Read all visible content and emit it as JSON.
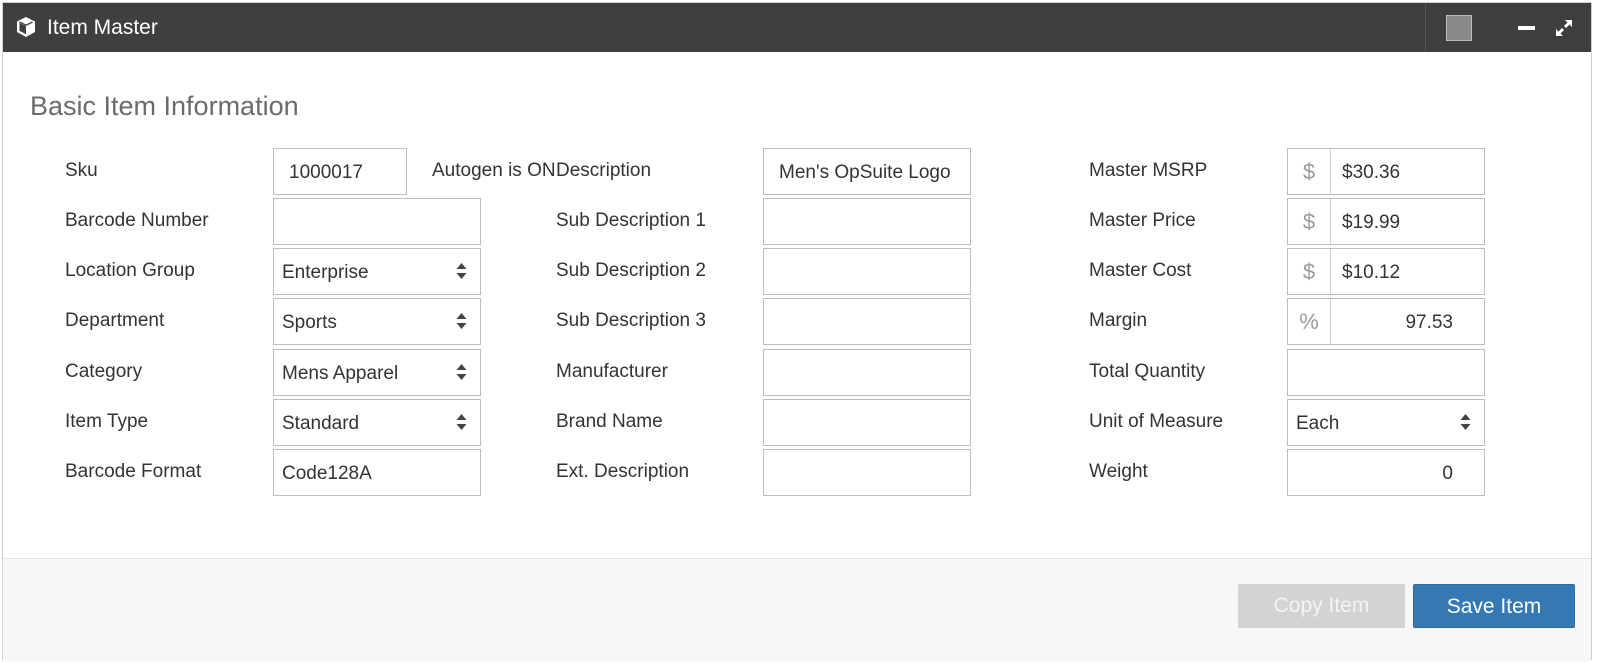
{
  "window": {
    "title": "Item Master",
    "colors": {
      "titlebar": "#3f3f3f",
      "primary": "#3479b4",
      "disabled": "#d3d3d3"
    }
  },
  "section": {
    "title": "Basic Item Information"
  },
  "autogen": "Autogen is ON",
  "left": {
    "sku": {
      "label": "Sku",
      "value": "1000017"
    },
    "barcode_number": {
      "label": "Barcode Number",
      "value": ""
    },
    "location_group": {
      "label": "Location Group",
      "value": "Enterprise"
    },
    "department": {
      "label": "Department",
      "value": "Sports"
    },
    "category": {
      "label": "Category",
      "value": "Mens Apparel"
    },
    "item_type": {
      "label": "Item Type",
      "value": "Standard"
    },
    "barcode_format": {
      "label": "Barcode Format",
      "value": "Code128A"
    }
  },
  "middle": {
    "description": {
      "label": "Description",
      "value": "Men's OpSuite Logo"
    },
    "sub_description_1": {
      "label": "Sub Description 1",
      "value": ""
    },
    "sub_description_2": {
      "label": "Sub Description 2",
      "value": ""
    },
    "sub_description_3": {
      "label": "Sub Description 3",
      "value": ""
    },
    "manufacturer": {
      "label": "Manufacturer",
      "value": ""
    },
    "brand_name": {
      "label": "Brand Name",
      "value": ""
    },
    "ext_description": {
      "label": "Ext. Description",
      "value": ""
    }
  },
  "right": {
    "master_msrp": {
      "label": "Master MSRP",
      "addon": "$",
      "value": "$30.36"
    },
    "master_price": {
      "label": "Master Price",
      "addon": "$",
      "value": "$19.99"
    },
    "master_cost": {
      "label": "Master Cost",
      "addon": "$",
      "value": "$10.12"
    },
    "margin": {
      "label": "Margin",
      "addon": "%",
      "value": "97.53"
    },
    "total_quantity": {
      "label": "Total Quantity",
      "value": ""
    },
    "unit_of_measure": {
      "label": "Unit of Measure",
      "value": "Each"
    },
    "weight": {
      "label": "Weight",
      "value": "0"
    }
  },
  "footer": {
    "copy_label": "Copy Item",
    "save_label": "Save Item"
  },
  "icons": {
    "title": "cube-icon",
    "color": "color-swatch-icon",
    "minimize": "minimize-icon",
    "maximize": "expand-icon",
    "select": "select-arrows-icon"
  }
}
